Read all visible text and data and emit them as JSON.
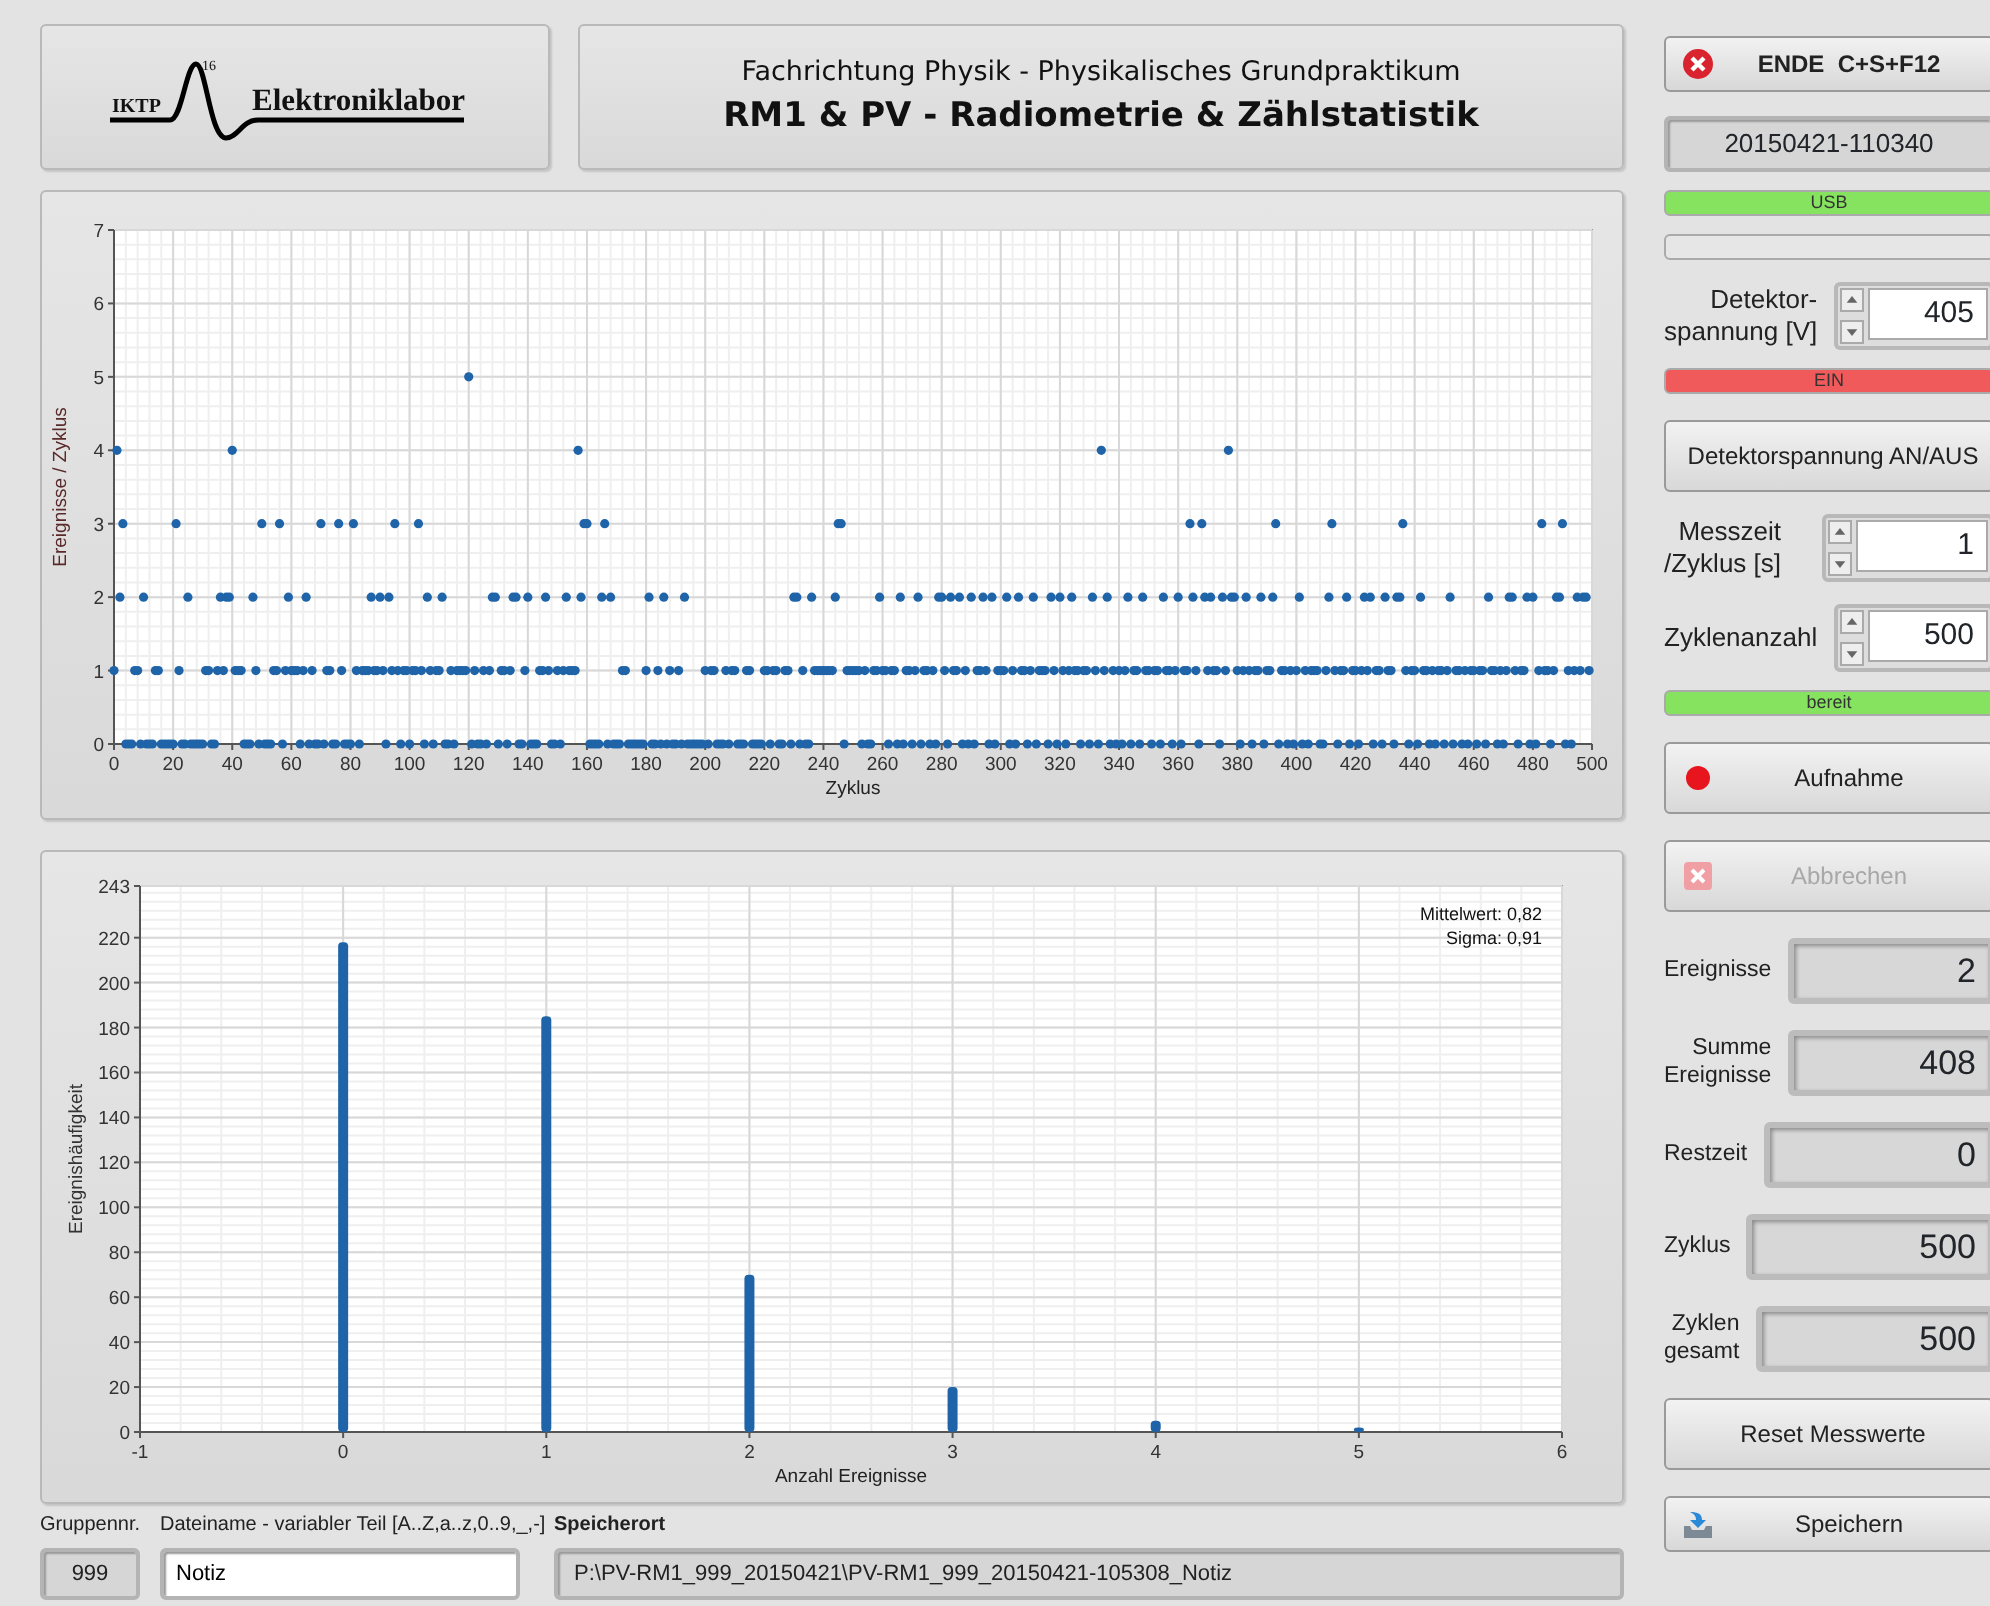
{
  "logo": {
    "abbreviation": "IKTP",
    "superscript": "16",
    "name": "Elektroniklabor"
  },
  "title": {
    "subtitle": "Fachrichtung Physik - Physikalisches Grundpraktikum",
    "main": "RM1 & PV - Radiometrie & Zählstatistik"
  },
  "scatter": {
    "chart_data": {
      "type": "scatter",
      "xlabel": "Zyklus",
      "ylabel": "Ereignisse / Zyklus",
      "grid": true,
      "xlim": [
        0,
        500
      ],
      "x": [
        0,
        1,
        2,
        3,
        4,
        5,
        6,
        7,
        8,
        9,
        10,
        11,
        12,
        13,
        14,
        15,
        16,
        17,
        18,
        19,
        20,
        21,
        22,
        23,
        24,
        25,
        26,
        27,
        28,
        29,
        30,
        31,
        32,
        33,
        34,
        35,
        36,
        37,
        38,
        39,
        40,
        41,
        42,
        43,
        44,
        45,
        46,
        47,
        48,
        49,
        50,
        51,
        52,
        53,
        54,
        55,
        56,
        57,
        58,
        59,
        60,
        61,
        62,
        63,
        64,
        65,
        66,
        67,
        68,
        69,
        70,
        71,
        72,
        73,
        74,
        75,
        76,
        77,
        78,
        79,
        80,
        81,
        82,
        83,
        84,
        85,
        86,
        87,
        88,
        89,
        90,
        91,
        92,
        93,
        94,
        95,
        96,
        97,
        98,
        99,
        100,
        101,
        102,
        103,
        104,
        105,
        106,
        107,
        108,
        109,
        110,
        111,
        112,
        113,
        114,
        115,
        116,
        117,
        118,
        119,
        120,
        121,
        122,
        123,
        124,
        125,
        126,
        127,
        128,
        129,
        130,
        131,
        132,
        133,
        134,
        135,
        136,
        137,
        138,
        139,
        140,
        141,
        142,
        143,
        144,
        145,
        146,
        147,
        148,
        149,
        150,
        151,
        152,
        153,
        154,
        155,
        156,
        157,
        158,
        159,
        160,
        161,
        162,
        163,
        164,
        165,
        166,
        167,
        168,
        169,
        170,
        171,
        172,
        173,
        174,
        175,
        176,
        177,
        178,
        179,
        180,
        181,
        182,
        183,
        184,
        185,
        186,
        187,
        188,
        189,
        190,
        191,
        192,
        193,
        194,
        195,
        196,
        197,
        198,
        199,
        200,
        201,
        202,
        203,
        204,
        205,
        206,
        207,
        208,
        209,
        210,
        211,
        212,
        213,
        214,
        215,
        216,
        217,
        218,
        219,
        220,
        221,
        222,
        223,
        224,
        225,
        226,
        227,
        228,
        229,
        230,
        231,
        232,
        233,
        234,
        235,
        236,
        237,
        238,
        239,
        240,
        241,
        242,
        243,
        244,
        245,
        246,
        247,
        248,
        249,
        250,
        251,
        252,
        253,
        254,
        255,
        256,
        257,
        258,
        259,
        260,
        261,
        262,
        263,
        264,
        265,
        266,
        267,
        268,
        269,
        270,
        271,
        272,
        273,
        274,
        275,
        276,
        277,
        278,
        279,
        280,
        281,
        282,
        283,
        284,
        285,
        286,
        287,
        288,
        289,
        290,
        291,
        292,
        293,
        294,
        295,
        296,
        297,
        298,
        299,
        300,
        301,
        302,
        303,
        304,
        305,
        306,
        307,
        308,
        309,
        310,
        311,
        312,
        313,
        314,
        315,
        316,
        317,
        318,
        319,
        320,
        321,
        322,
        323,
        324,
        325,
        326,
        327,
        328,
        329,
        330,
        331,
        332,
        333,
        334,
        335,
        336,
        337,
        338,
        339,
        340,
        341,
        342,
        343,
        344,
        345,
        346,
        347,
        348,
        349,
        350,
        351,
        352,
        353,
        354,
        355,
        356,
        357,
        358,
        359,
        360,
        361,
        362,
        363,
        364,
        365,
        366,
        367,
        368,
        369,
        370,
        371,
        372,
        373,
        374,
        375,
        376,
        377,
        378,
        379,
        380,
        381,
        382,
        383,
        384,
        385,
        386,
        387,
        388,
        389,
        390,
        391,
        392,
        393,
        394,
        395,
        396,
        397,
        398,
        399,
        400,
        401,
        402,
        403,
        404,
        405,
        406,
        407,
        408,
        409,
        410,
        411,
        412,
        413,
        414,
        415,
        416,
        417,
        418,
        419,
        420,
        421,
        422,
        423,
        424,
        425,
        426,
        427,
        428,
        429,
        430,
        431,
        432,
        433,
        434,
        435,
        436,
        437,
        438,
        439,
        440,
        441,
        442,
        443,
        444,
        445,
        446,
        447,
        448,
        449,
        450,
        451,
        452,
        453,
        454,
        455,
        456,
        457,
        458,
        459,
        460,
        461,
        462,
        463,
        464,
        465,
        466,
        467,
        468,
        469,
        470,
        471,
        472,
        473,
        474,
        475,
        476,
        477,
        478,
        479,
        480,
        481,
        482,
        483,
        484,
        485,
        486,
        487,
        488,
        489,
        490,
        491,
        492,
        493,
        494,
        495,
        496,
        497,
        498,
        499
      ],
      "ylim": [
        0,
        7
      ],
      "xticks": [
        0,
        20,
        40,
        60,
        80,
        100,
        120,
        140,
        160,
        180,
        200,
        220,
        240,
        260,
        280,
        300,
        320,
        340,
        360,
        380,
        400,
        420,
        440,
        460,
        480,
        500
      ],
      "yticks": [
        0,
        1,
        2,
        3,
        4,
        5,
        6,
        7
      ],
      "series": [
        {
          "color": "#1f64a8",
          "values": [
            1,
            4,
            2,
            3,
            0,
            0,
            0,
            1,
            1,
            0,
            2,
            0,
            0,
            0,
            1,
            1,
            0,
            0,
            0,
            0,
            0,
            3,
            1,
            0,
            0,
            2,
            0,
            0,
            0,
            0,
            0,
            1,
            1,
            0,
            0,
            1,
            2,
            1,
            2,
            2,
            4,
            1,
            1,
            1,
            0,
            0,
            0,
            2,
            1,
            0,
            3,
            0,
            0,
            0,
            1,
            1,
            3,
            0,
            1,
            2,
            1,
            1,
            1,
            0,
            1,
            2,
            0,
            1,
            0,
            0,
            3,
            0,
            1,
            1,
            0,
            0,
            3,
            1,
            0,
            0,
            0,
            3,
            1,
            0,
            1,
            1,
            1,
            2,
            1,
            1,
            2,
            1,
            0,
            2,
            1,
            3,
            1,
            0,
            1,
            1,
            0,
            1,
            1,
            3,
            1,
            0,
            2,
            1,
            0,
            1,
            1,
            2,
            0,
            0,
            1,
            0,
            1,
            1,
            1,
            1,
            5,
            0,
            1,
            0,
            0,
            1,
            0,
            1,
            2,
            2,
            0,
            1,
            1,
            0,
            1,
            2,
            2,
            0,
            0,
            1,
            2,
            0,
            0,
            0,
            1,
            1,
            2,
            1,
            0,
            0,
            1,
            0,
            1,
            2,
            1,
            1,
            1,
            4,
            2,
            3,
            3,
            0,
            0,
            0,
            0,
            2,
            3,
            0,
            2,
            0,
            0,
            0,
            1,
            1,
            0,
            0,
            0,
            0,
            0,
            0,
            1,
            2,
            0,
            0,
            1,
            0,
            2,
            0,
            1,
            0,
            0,
            1,
            0,
            2,
            0,
            0,
            0,
            0,
            0,
            0,
            1,
            0,
            1,
            1,
            0,
            0,
            0,
            1,
            0,
            1,
            1,
            0,
            0,
            0,
            1,
            1,
            0,
            0,
            0,
            0,
            1,
            1,
            0,
            1,
            1,
            0,
            0,
            1,
            1,
            0,
            2,
            2,
            0,
            1,
            0,
            0,
            2,
            1,
            1,
            1,
            1,
            1,
            1,
            1,
            2,
            3,
            3,
            0,
            1,
            1,
            1,
            1,
            1,
            0,
            1,
            0,
            0,
            1,
            1,
            2,
            1,
            1,
            0,
            1,
            1,
            0,
            2,
            0,
            1,
            1,
            0,
            1,
            2,
            0,
            1,
            1,
            0,
            1,
            0,
            2,
            2,
            1,
            0,
            2,
            1,
            1,
            2,
            0,
            1,
            0,
            2,
            0,
            1,
            1,
            2,
            1,
            0,
            2,
            0,
            1,
            1,
            1,
            2,
            0,
            1,
            0,
            2,
            1,
            1,
            0,
            1,
            2,
            0,
            1,
            1,
            1,
            0,
            2,
            1,
            0,
            2,
            1,
            0,
            1,
            2,
            1,
            1,
            0,
            1,
            1,
            0,
            2,
            1,
            0,
            4,
            1,
            2,
            0,
            1,
            0,
            1,
            0,
            1,
            2,
            0,
            1,
            1,
            0,
            2,
            1,
            1,
            0,
            1,
            1,
            0,
            2,
            1,
            1,
            0,
            1,
            2,
            0,
            1,
            1,
            3,
            2,
            1,
            0,
            3,
            2,
            1,
            2,
            1,
            1,
            0,
            2,
            1,
            4,
            2,
            2,
            1,
            0,
            1,
            2,
            1,
            0,
            1,
            1,
            2,
            0,
            1,
            1,
            2,
            3,
            0,
            1,
            1,
            0,
            1,
            0,
            1,
            2,
            0,
            1,
            0,
            1,
            1,
            1,
            0,
            0,
            1,
            2,
            3,
            1,
            0,
            1,
            1,
            2,
            0,
            1,
            1,
            0,
            1,
            2,
            1,
            2,
            0,
            1,
            1,
            0,
            2,
            1,
            1,
            0,
            2,
            2,
            3,
            1,
            0,
            1,
            1,
            0,
            2,
            1,
            1,
            0,
            1,
            0,
            1,
            1,
            0,
            1,
            2,
            0,
            1,
            1,
            0,
            1,
            0,
            1,
            1,
            0,
            1,
            1,
            0,
            2,
            1,
            1,
            0,
            1,
            0,
            1,
            2,
            2,
            1,
            0,
            1,
            1,
            2,
            0,
            2,
            0,
            1,
            3,
            1,
            1,
            0,
            1,
            2,
            2,
            3,
            0,
            1,
            0,
            1,
            2,
            1,
            2,
            2,
            1
          ]
        }
      ]
    }
  },
  "histogram": {
    "chart_data": {
      "type": "bar",
      "xlabel": "Anzahl Ereignisse",
      "ylabel": "Ereignishäufigkeit",
      "grid": true,
      "x": [
        0,
        1,
        2,
        3,
        4,
        5
      ],
      "xlim": [
        -1,
        6
      ],
      "ylim": [
        0,
        243
      ],
      "xticks": [
        -1,
        0,
        1,
        2,
        3,
        4,
        5,
        6
      ],
      "yticks": [
        0,
        20,
        40,
        60,
        80,
        100,
        120,
        140,
        160,
        180,
        200,
        220,
        243
      ],
      "series": [
        {
          "color": "#1f64a8",
          "values": [
            218,
            185,
            70,
            20,
            5,
            2
          ]
        }
      ],
      "annotations": [
        "Mittelwert: 0,82",
        "Sigma: 0,91"
      ]
    }
  },
  "bottom_bar": {
    "group": {
      "label": "Gruppennr.",
      "value": "999"
    },
    "filename": {
      "label": "Dateiname - variabler Teil [A..Z,a..z,0..9,_,-]",
      "value": "Notiz"
    },
    "location": {
      "label": "Speicherort",
      "value": "P:\\PV-RM1_999_20150421\\PV-RM1_999_20150421-105308_Notiz"
    }
  },
  "right_panel": [
    {
      "kind": "exit",
      "label": "ENDE  C+S+F12",
      "disabled": false
    },
    {
      "kind": "display",
      "value": "20150421-110340"
    },
    {
      "kind": "led",
      "label": "USB",
      "color": "#86e35f"
    },
    {
      "kind": "led",
      "color": "#e6e6e6"
    },
    {
      "kind": "control",
      "label": "Detektor-\nspannung [V]",
      "value": "405"
    },
    {
      "kind": "led",
      "label": "EIN",
      "color": "#f05a5a"
    },
    {
      "kind": "button",
      "label": "Detektorspannung AN/AUS",
      "disabled": false
    },
    {
      "kind": "control",
      "label": "Messzeit\n/Zyklus [s]",
      "value": "1"
    },
    {
      "kind": "control",
      "label": "Zyklenanzahl",
      "value": "500"
    },
    {
      "kind": "led",
      "label": "bereit",
      "color": "#86e35f"
    },
    {
      "kind": "record",
      "lamp_on": true,
      "label": "Aufnahme",
      "disabled": false
    },
    {
      "kind": "cancel",
      "label": "Abbrechen",
      "disabled": true
    },
    {
      "kind": "indicator",
      "label": "Ereignisse",
      "value": "2"
    },
    {
      "kind": "indicator",
      "label": "Summe\nEreignisse",
      "value": "408"
    },
    {
      "kind": "indicator",
      "label": "Restzeit",
      "value": "0"
    },
    {
      "kind": "indicator",
      "label": "Zyklus",
      "value": "500"
    },
    {
      "kind": "indicator",
      "label": "Zyklen\ngesamt",
      "value": "500"
    },
    {
      "kind": "button",
      "label": "Reset Messwerte",
      "disabled": false
    },
    {
      "kind": "save",
      "label": "Speichern",
      "disabled": false
    }
  ]
}
